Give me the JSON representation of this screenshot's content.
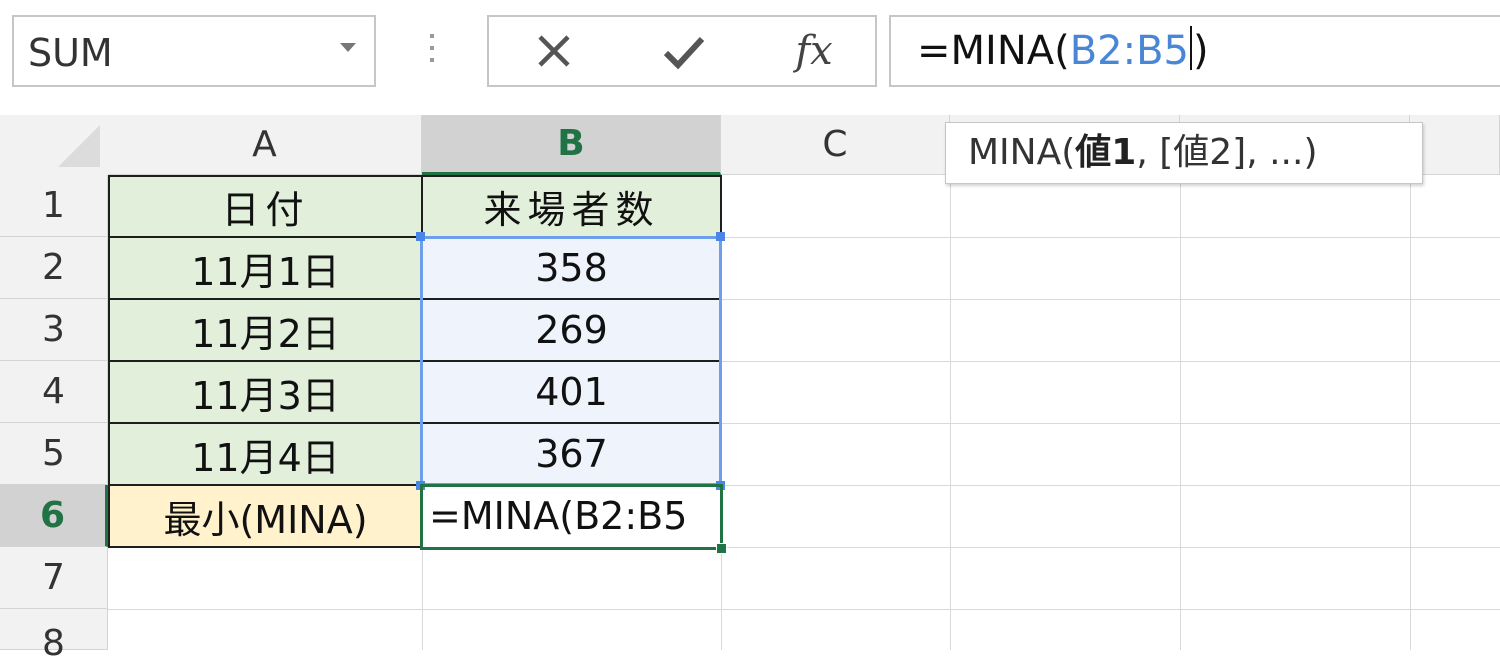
{
  "name_box": {
    "value": "SUM"
  },
  "formula_bar": {
    "cancel_icon": "close-icon",
    "enter_icon": "checkmark-icon",
    "fx_label": "fx",
    "formula_prefix": "=MINA(",
    "formula_ref": "B2:B5",
    "formula_suffix": ")"
  },
  "columns": [
    "A",
    "B",
    "C"
  ],
  "rows": [
    "1",
    "2",
    "3",
    "4",
    "5",
    "6",
    "7",
    "8"
  ],
  "active_column": "B",
  "active_row": "6",
  "cells": {
    "A1": "日付",
    "B1": "来場者数",
    "A2": "11月1日",
    "B2": "358",
    "A3": "11月2日",
    "B3": "269",
    "A4": "11月3日",
    "B4": "401",
    "A5": "11月4日",
    "B5": "367",
    "A6": "最小(MINA)",
    "B6": "=MINA(B2:B5"
  },
  "tooltip": {
    "func": "MINA(",
    "arg1": "値1",
    "rest": ", [値2], ...)"
  },
  "colors": {
    "excel_green": "#217346",
    "range_blue": "#6d9eeb",
    "label_fill": "#e2efda",
    "result_fill": "#fff2cc",
    "range_fill": "#eef3fc"
  }
}
